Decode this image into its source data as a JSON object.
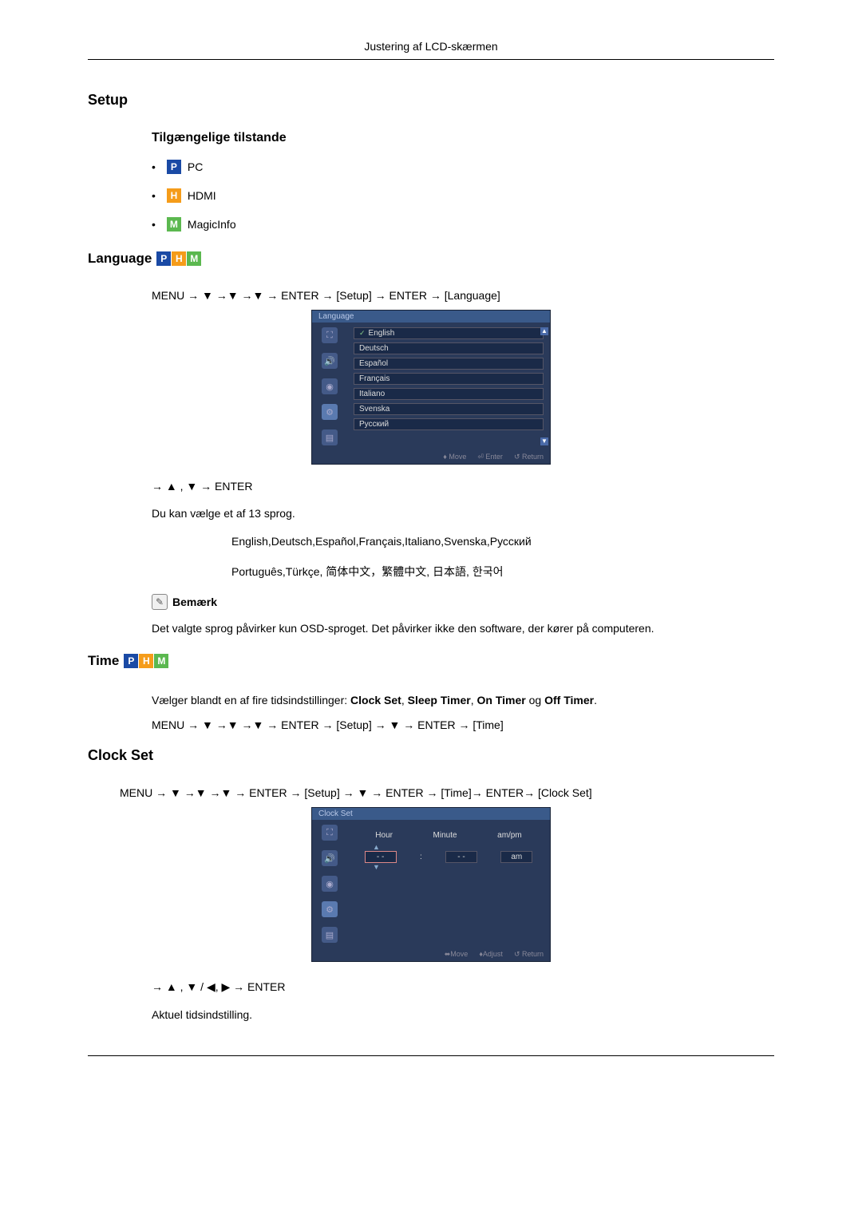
{
  "header": "Justering af LCD-skærmen",
  "setup": {
    "title": "Setup",
    "modesTitle": "Tilgængelige tilstande",
    "modes": [
      {
        "badge": "P",
        "label": "PC"
      },
      {
        "badge": "H",
        "label": "HDMI"
      },
      {
        "badge": "M",
        "label": "MagicInfo"
      }
    ]
  },
  "language": {
    "title": "Language",
    "nav": "MENU → ▼ →▼ →▼ → ENTER → [Setup] → ENTER → [Language]",
    "osdTitle": "Language",
    "langs": [
      "English",
      "Deutsch",
      "Español",
      "Français",
      "Italiano",
      "Svenska",
      "Русский"
    ],
    "footerMove": "♦ Move",
    "footerEnter": "⏎ Enter",
    "footerReturn": "↺ Return",
    "navArrows": "→ ▲ , ▼ → ENTER",
    "body1": "Du kan vælge et af 13 sprog.",
    "langList1": "English,Deutsch,Español,Français,Italiano,Svenska,Русский",
    "langList2": "Português,Türkçe, 简体中文，繁體中文, 日本語, 한국어",
    "noteLabel": "Bemærk",
    "noteText": "Det valgte sprog påvirker kun OSD-sproget. Det påvirker ikke den software, der kører på computeren."
  },
  "time": {
    "title": "Time",
    "intro": "Vælger blandt en af fire tidsindstillinger: Clock Set, Sleep Timer, On Timer og Off Timer.",
    "nav": "MENU → ▼ →▼ →▼ → ENTER → [Setup] → ▼ → ENTER → [Time]"
  },
  "clockSet": {
    "title": "Clock Set",
    "nav": "MENU → ▼ →▼ →▼ → ENTER → [Setup] → ▼ → ENTER → [Time]→ ENTER→ [Clock Set]",
    "osdTitle": "Clock Set",
    "colHour": "Hour",
    "colMinute": "Minute",
    "colAmPm": "am/pm",
    "valHour": "- -",
    "valMinute": "- -",
    "valAmPm": "am",
    "footerMove": "⬌Move",
    "footerAdjust": "♦Adjust",
    "footerReturn": "↺ Return",
    "navArrows": "→ ▲ , ▼ / ◀, ▶ → ENTER",
    "body": "Aktuel tidsindstilling."
  }
}
